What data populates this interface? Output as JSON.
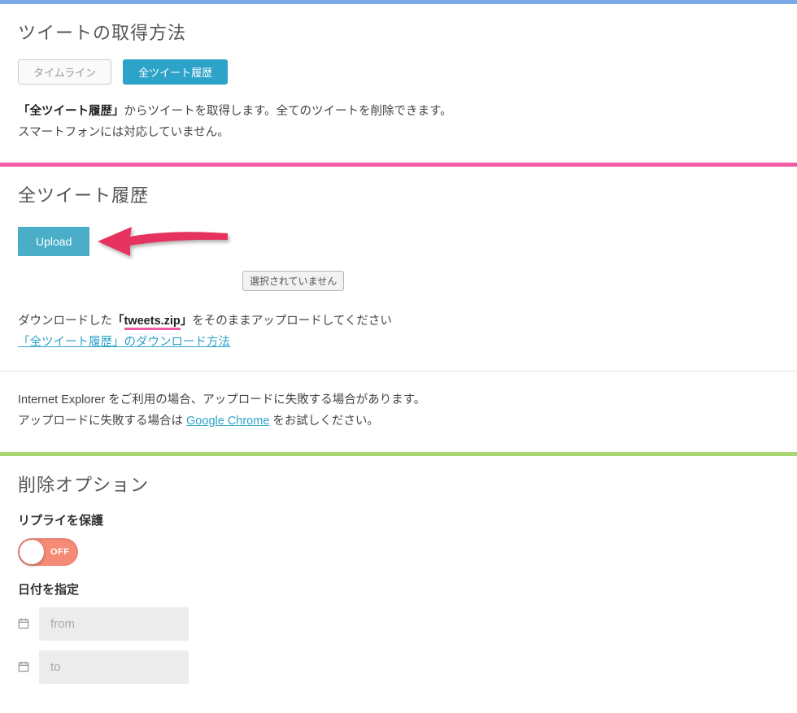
{
  "section1": {
    "heading": "ツイートの取得方法",
    "tab_timeline": "タイムライン",
    "tab_archive": "全ツイート履歴",
    "desc_bold": "「全ツイート履歴」",
    "desc_rest": "からツイートを取得します。全てのツイートを削除できます。",
    "desc_line2": "スマートフォンには対応していません。"
  },
  "section2": {
    "heading": "全ツイート履歴",
    "upload_btn": "Upload",
    "file_status": "選択されていません",
    "upload_desc_pre": "ダウンロードした",
    "upload_desc_bold_open": "「",
    "upload_desc_underlined": "tweets.zip",
    "upload_desc_bold_close": "」",
    "upload_desc_post": "をそのままアップロードしてください",
    "download_link": "「全ツイート履歴」のダウンロード方法",
    "ie_warning": "Internet Explorer をご利用の場合、アップロードに失敗する場合があります。",
    "chrome_pre": "アップロードに失敗する場合は ",
    "chrome_link": "Google Chrome",
    "chrome_post": " をお試しください。"
  },
  "section3": {
    "heading": "削除オプション",
    "protect_replies_label": "リプライを保護",
    "toggle_off": "OFF",
    "date_range_label": "日付を指定",
    "from_placeholder": "from",
    "to_placeholder": "to"
  }
}
